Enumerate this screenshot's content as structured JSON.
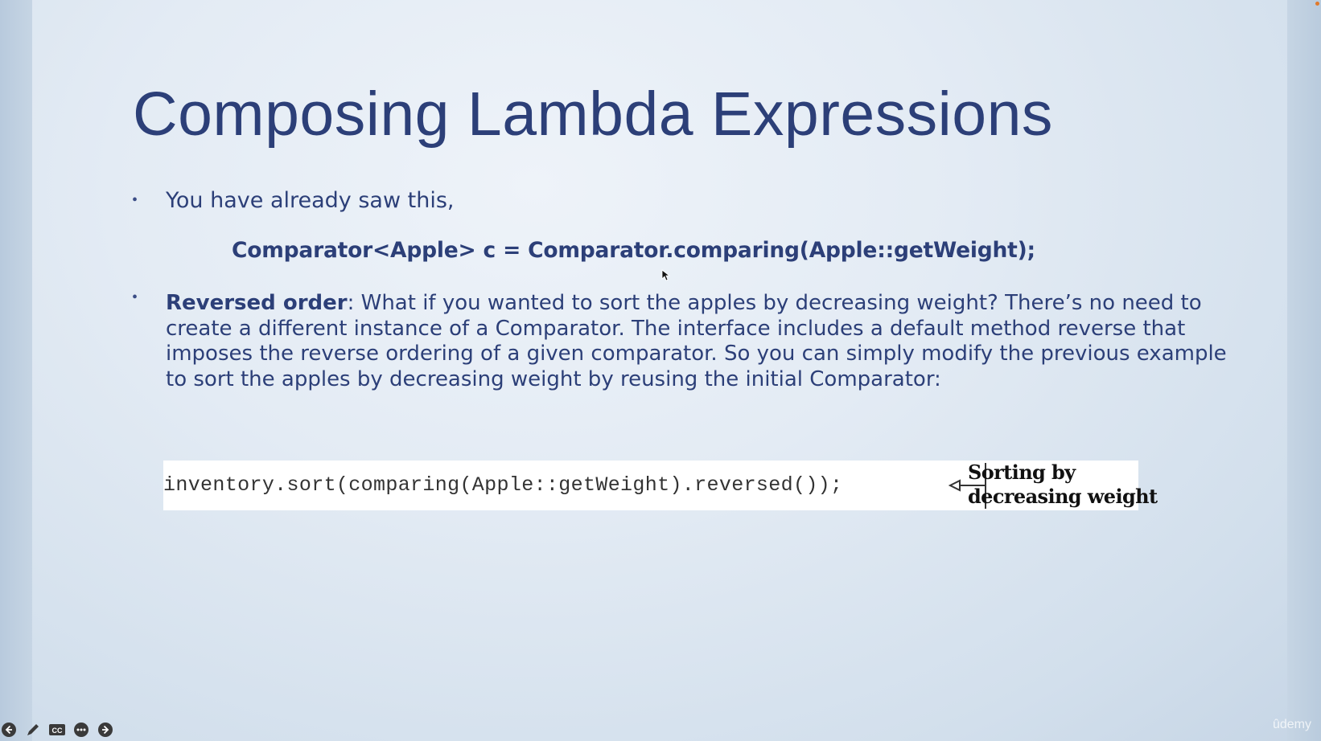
{
  "slide": {
    "title": "Composing Lambda Expressions",
    "bullet1": "You have already saw this,",
    "code_line": "Comparator<Apple> c = Comparator.comparing(Apple::getWeight);",
    "bullet2_bold": "Reversed order",
    "bullet2_text": ": What if you wanted to sort the apples by decreasing weight? There’s no need to create a different instance of a Comparator. The interface includes a default method reverse that imposes the reverse ordering of a given comparator. So you can simply modify the previous example to sort the apples by decreasing weight by reusing the initial Comparator:",
    "code_box": {
      "code": "inventory.sort(comparing(Apple::getWeight).reversed());",
      "annotation_line1": "Sorting by",
      "annotation_line2": "decreasing weight"
    }
  },
  "player": {
    "watermark": "ûdemy",
    "controls": [
      "previous-icon",
      "pen-icon",
      "captions-icon",
      "more-icon",
      "next-icon"
    ],
    "captions_label": "CC"
  },
  "colors": {
    "title": "#2c3f78",
    "accent_dot": "#e07a2c"
  }
}
